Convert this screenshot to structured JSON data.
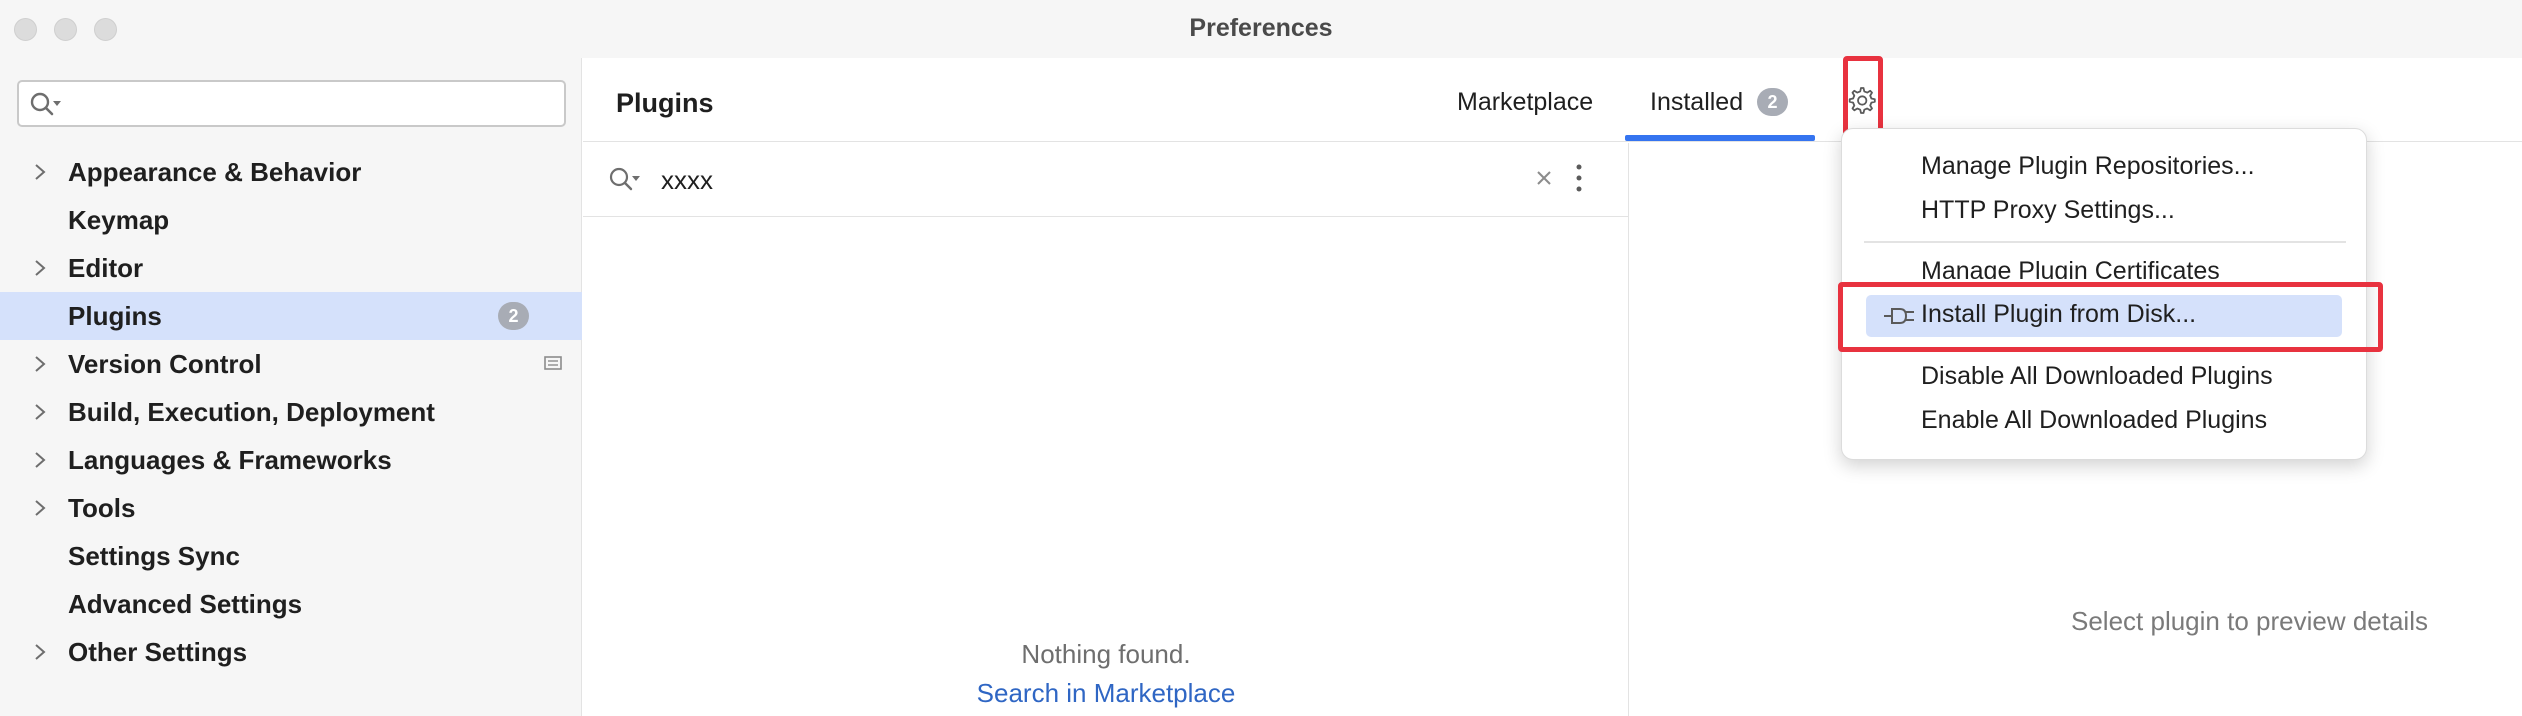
{
  "window": {
    "title": "Preferences"
  },
  "sidebar": {
    "search_placeholder": "",
    "items": [
      {
        "label": "Appearance & Behavior",
        "expandable": true
      },
      {
        "label": "Keymap",
        "expandable": false
      },
      {
        "label": "Editor",
        "expandable": true
      },
      {
        "label": "Plugins",
        "expandable": false,
        "selected": true,
        "badge": "2"
      },
      {
        "label": "Version Control",
        "expandable": true
      },
      {
        "label": "Build, Execution, Deployment",
        "expandable": true
      },
      {
        "label": "Languages & Frameworks",
        "expandable": true
      },
      {
        "label": "Tools",
        "expandable": true
      },
      {
        "label": "Settings Sync",
        "expandable": false
      },
      {
        "label": "Advanced Settings",
        "expandable": false
      },
      {
        "label": "Other Settings",
        "expandable": true
      }
    ]
  },
  "main": {
    "title": "Plugins",
    "tabs": [
      {
        "label": "Marketplace",
        "active": false
      },
      {
        "label": "Installed",
        "active": true,
        "badge": "2"
      }
    ],
    "search": {
      "value": "xxxx"
    },
    "empty_message": "Nothing found.",
    "empty_link": "Search in Marketplace",
    "preview_placeholder": "Select plugin to preview details"
  },
  "menu": {
    "items": [
      "Manage Plugin Repositories...",
      "HTTP Proxy Settings...",
      "Manage Plugin Certificates",
      "Install Plugin from Disk...",
      "Disable All Downloaded Plugins",
      "Enable All Downloaded Plugins"
    ],
    "selected_index": 3
  },
  "colors": {
    "accent": "#3574f0",
    "selection": "#d5e1fb",
    "highlight_box": "#e8323f",
    "link": "#2f66c4"
  }
}
